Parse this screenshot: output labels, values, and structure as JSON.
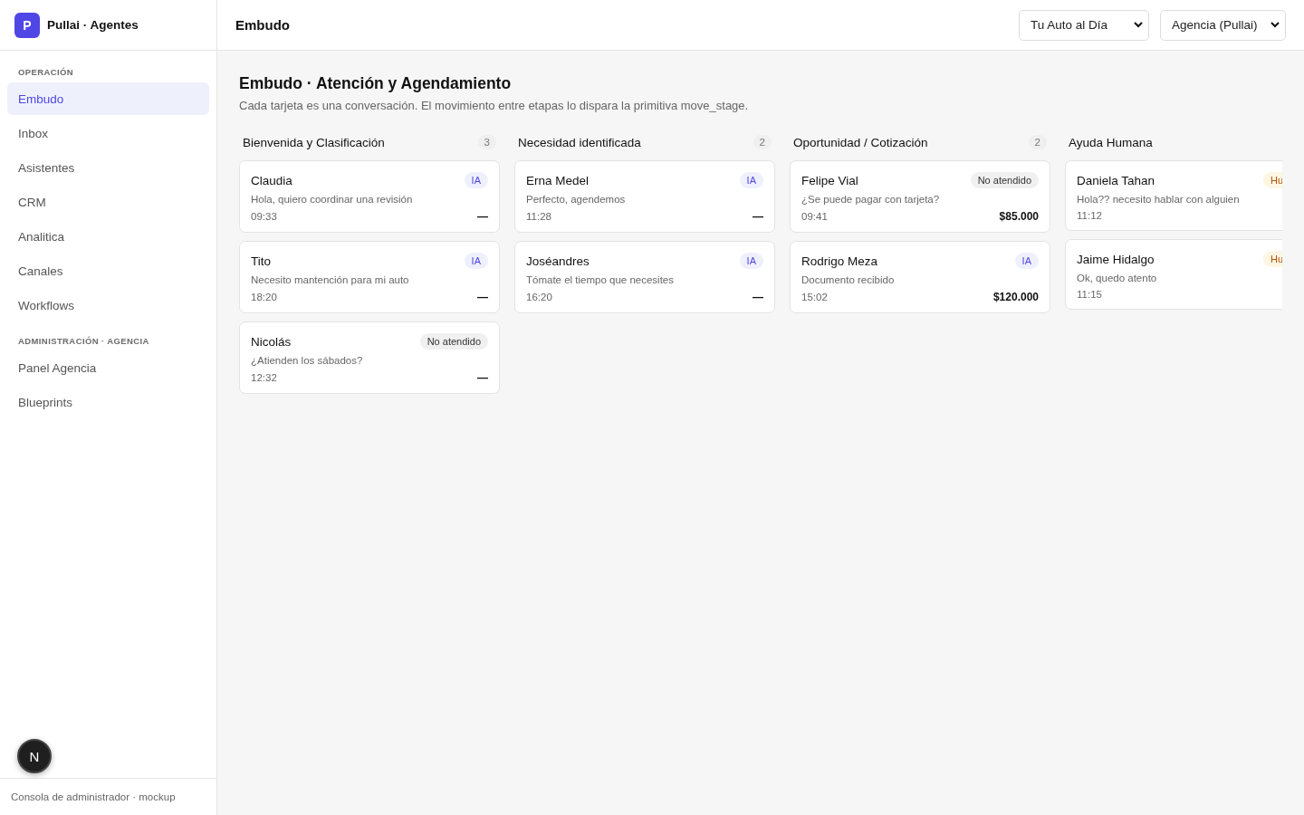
{
  "brand": {
    "logo": "P",
    "name": "Pullai · Agentes"
  },
  "sidebar": {
    "sections": [
      {
        "title": "OPERACIÓN",
        "items": [
          {
            "label": "Embudo",
            "selected": true
          },
          {
            "label": "Inbox",
            "selected": false
          },
          {
            "label": "Asistentes",
            "selected": false
          },
          {
            "label": "CRM",
            "selected": false
          },
          {
            "label": "Analitica",
            "selected": false
          },
          {
            "label": "Canales",
            "selected": false
          },
          {
            "label": "Workflows",
            "selected": false
          }
        ]
      },
      {
        "title": "ADMINISTRACIÓN · AGENCIA",
        "items": [
          {
            "label": "Panel Agencia",
            "selected": false
          },
          {
            "label": "Blueprints",
            "selected": false
          }
        ]
      }
    ],
    "footer": "Consola de administrador · mockup"
  },
  "topbar": {
    "title": "Embudo",
    "selects": [
      "Tu Auto al Día",
      "Agencia (Pullai)"
    ]
  },
  "page": {
    "title": "Embudo · Atención y Agendamiento",
    "subtitle": "Cada tarjeta es una conversación. El movimiento entre etapas lo dispara la primitiva move_stage."
  },
  "columns": [
    {
      "title": "Bienvenida y Clasificación",
      "count": "3",
      "cards": [
        {
          "name": "Claudia",
          "badge": {
            "kind": "ai",
            "label": "IA"
          },
          "message": "Hola, quiero coordinar una revisión",
          "time": "09:33",
          "value": "—"
        },
        {
          "name": "Tito",
          "badge": {
            "kind": "ai",
            "label": "IA"
          },
          "message": "Necesito mantención para mi auto",
          "time": "18:20",
          "value": "—"
        },
        {
          "name": "Nicolás",
          "badge": {
            "kind": "unattended",
            "label": "No atendido"
          },
          "message": "¿Atienden los sábados?",
          "time": "12:32",
          "value": "—"
        }
      ]
    },
    {
      "title": "Necesidad identificada",
      "count": "2",
      "cards": [
        {
          "name": "Erna Medel",
          "badge": {
            "kind": "ai",
            "label": "IA"
          },
          "message": "Perfecto, agendemos",
          "time": "11:28",
          "value": "—"
        },
        {
          "name": "Joséandres",
          "badge": {
            "kind": "ai",
            "label": "IA"
          },
          "message": "Tómate el tiempo que necesites",
          "time": "16:20",
          "value": "—"
        }
      ]
    },
    {
      "title": "Oportunidad / Cotización",
      "count": "2",
      "cards": [
        {
          "name": "Felipe Vial",
          "badge": {
            "kind": "unattended",
            "label": "No atendido"
          },
          "message": "¿Se puede pagar con tarjeta?",
          "time": "09:41",
          "value": "$85.000"
        },
        {
          "name": "Rodrigo Meza",
          "badge": {
            "kind": "ai",
            "label": "IA"
          },
          "message": "Documento recibido",
          "time": "15:02",
          "value": "$120.000"
        }
      ]
    },
    {
      "title": "Ayuda Humana",
      "cards": [
        {
          "name": "Daniela Tahan",
          "badge": {
            "kind": "human",
            "label": "Hu"
          },
          "message": "Hola?? necesito hablar con alguien",
          "time": "11:12"
        },
        {
          "name": "Jaime Hidalgo",
          "badge": {
            "kind": "human",
            "label": "Hu"
          },
          "message": "Ok, quedo atento",
          "time": "11:15"
        }
      ]
    }
  ],
  "dev_badge": "N"
}
